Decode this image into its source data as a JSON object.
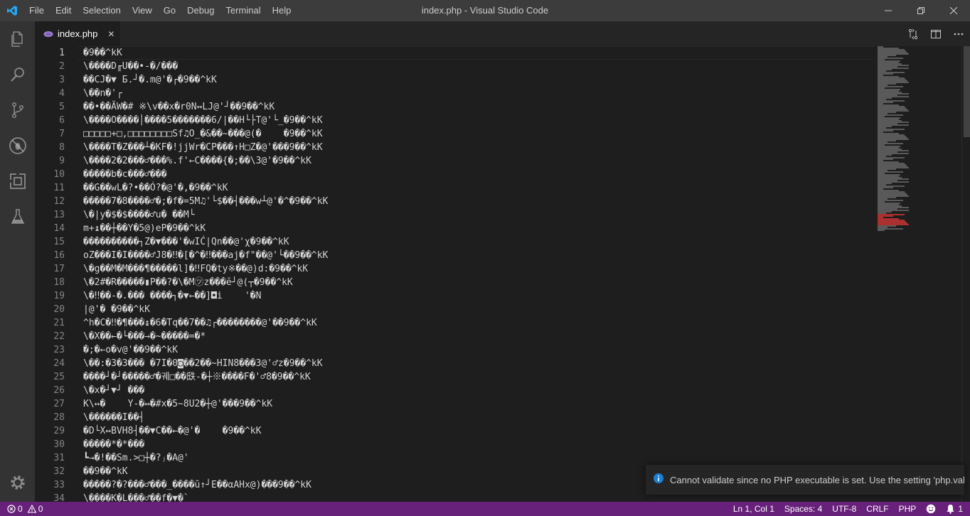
{
  "titlebar": {
    "menu": [
      "File",
      "Edit",
      "Selection",
      "View",
      "Go",
      "Debug",
      "Terminal",
      "Help"
    ],
    "window_title": "index.php - Visual Studio Code"
  },
  "activitybar": {
    "items": [
      "files-icon",
      "search-icon",
      "source-control-icon",
      "debug-icon",
      "extensions-icon",
      "test-flask-icon"
    ],
    "bottom": "gear-icon"
  },
  "tab": {
    "label": "index.php",
    "close": "✕"
  },
  "editor": {
    "line_numbers": [
      "1",
      "2",
      "3",
      "4",
      "5",
      "6",
      "7",
      "8",
      "9",
      "10",
      "11",
      "12",
      "13",
      "14",
      "15",
      "16",
      "17",
      "18",
      "19",
      "20",
      "21",
      "22",
      "23",
      "24",
      "25",
      "26",
      "27",
      "28",
      "29",
      "30",
      "31",
      "32",
      "33",
      "34"
    ],
    "lines": [
      "�9��^kK",
      "\\����D╓U��•-�/���",
      "��CJ�▼ Б.┘�.m@'�┌�9��^kK",
      "\\��n�'┌",
      "��•��ÃW�# ※\\v��x�r0N↔LJ@'┘��9��^kK",
      "\\����O����│����5�������6/|��H└├T@'└_�9��^kK",
      "□□□□□+□,□□□□□□□□Sf♫O_�&��~���@(�    �9��^kK",
      "\\����T�Z���┴�KF�!jjWr�CP���↑H□Z�@'���9��^kK",
      "\\����2�2���♂���%.f'←C����{�;��\\3@'�9��^kK",
      "�����b�c���♂���",
      "��G��wL�?•��Ó?�@'�,�9��^kK",
      "�����7�8����♂�;�f�=5M♫'└$��┤���w┴@'�^�9��^kK",
      "\\�|y�$�$����♂u� ��M└",
      "m+↨��┼��Y�5@)eP�9��^kK",
      "����������┐Z�▼���'�wIĆ|Qn��@'χ�9��^kK",
      "oZ���I�I����♂J8�‼�[�^�‼���aj�f\"��@'└��9��^kK",
      "\\�g��M�M���¶�����l]�‼FQ�ty※��@)d:�9��^kK",
      "\\�2#�R�����▮P��?�\\�M㋡z���ĕ┘@(┬�9��^kK",
      "\\�‼��-�.��� ����┐�▼←��]◘i    '�N",
      "|@'� �9��^kK",
      "^h�C�‼�¶���↨�6�Tq��7��♫┌��������@'��9��^kK",
      "\\�X��←�└���→�~�����=�*",
      "�;�←o�v@'��9��^kK",
      "\\��:�3�3��� �7I�0◙��2��~HIN8���3@'♂z�9��^kK",
      "����┘�┘�����♂�궤□��㲳-�┼※����F�'♂8�9��^kK",
      "\\�x�┘▼┘ ���",
      "K\\↔�    Y-�↔�#x�5~8U2�┼@'���9��^kK",
      "\\������I��┤",
      "�D└X↔BVH8┤��▼C��←�@'�    �9��^kK",
      "�����*�*���",
      "┗→�!��Sm.>□┼�?ⱼ�A@'",
      "��9��^kK",
      "�����?�?���♂���_����ŭ↑┘E��αAHx@)���9��^kK",
      "\\����K�L���♂��f�▼�`"
    ]
  },
  "notification": {
    "icon": "info-icon",
    "text": "Cannot validate since no PHP executable is set. Use the setting 'php.val..."
  },
  "statusbar": {
    "errors": "0",
    "warnings": "0",
    "position": "Ln 1, Col 1",
    "spaces": "Spaces: 4",
    "encoding": "UTF-8",
    "eol": "CRLF",
    "language": "PHP",
    "notifications_count": "1",
    "color": "#68217a"
  }
}
